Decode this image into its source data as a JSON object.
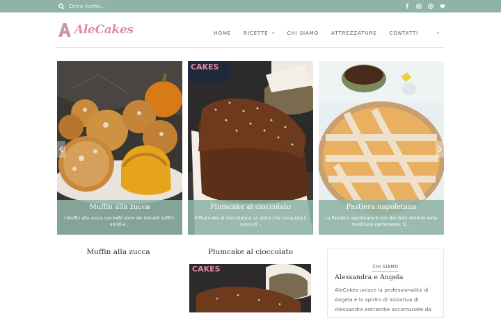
{
  "topbar": {
    "search_placeholder": "Cerca ricetta...",
    "social_icons": [
      "facebook-icon",
      "instagram-icon",
      "pinterest-icon",
      "heart-icon"
    ],
    "color": "#8fb4a6"
  },
  "header": {
    "logo_text": "AleCakes",
    "nav": [
      {
        "label": "HOME"
      },
      {
        "label": "RICETTE",
        "has_dropdown": true
      },
      {
        "label": "CHI SIAMO"
      },
      {
        "label": "ATTREZZATURE"
      },
      {
        "label": "CONTATTI"
      }
    ]
  },
  "slider": {
    "slides": [
      {
        "title": "Muffin alla zucca",
        "excerpt": "I Muffin alla zucca con kefir sono dei dolcetti soffici, umidi e..."
      },
      {
        "title": "Plumcake al cioccolato",
        "excerpt": "Il Plumcake al cioccolato è un dolce che conquista il cuore di..."
      },
      {
        "title": "Pastiera napoletana",
        "excerpt": "La Pastiera napoletana è uno dei dolci simbolo della tradizione partenopea. Si..."
      }
    ],
    "thumb_label": "CAKES"
  },
  "posts": [
    {
      "title": "Muffin alla zucca"
    },
    {
      "title": "Plumcake al cioccolato"
    }
  ],
  "widget": {
    "heading": "CHI SIAMO",
    "name": "Alessandra e Angela",
    "text": "AleCakes unisce la professionalità di Angela e lo spirito di iniziativa di Alessandra entrambe accomunate da"
  },
  "colors": {
    "accent": "#8fb4a6",
    "logo": "#e38aa0"
  }
}
